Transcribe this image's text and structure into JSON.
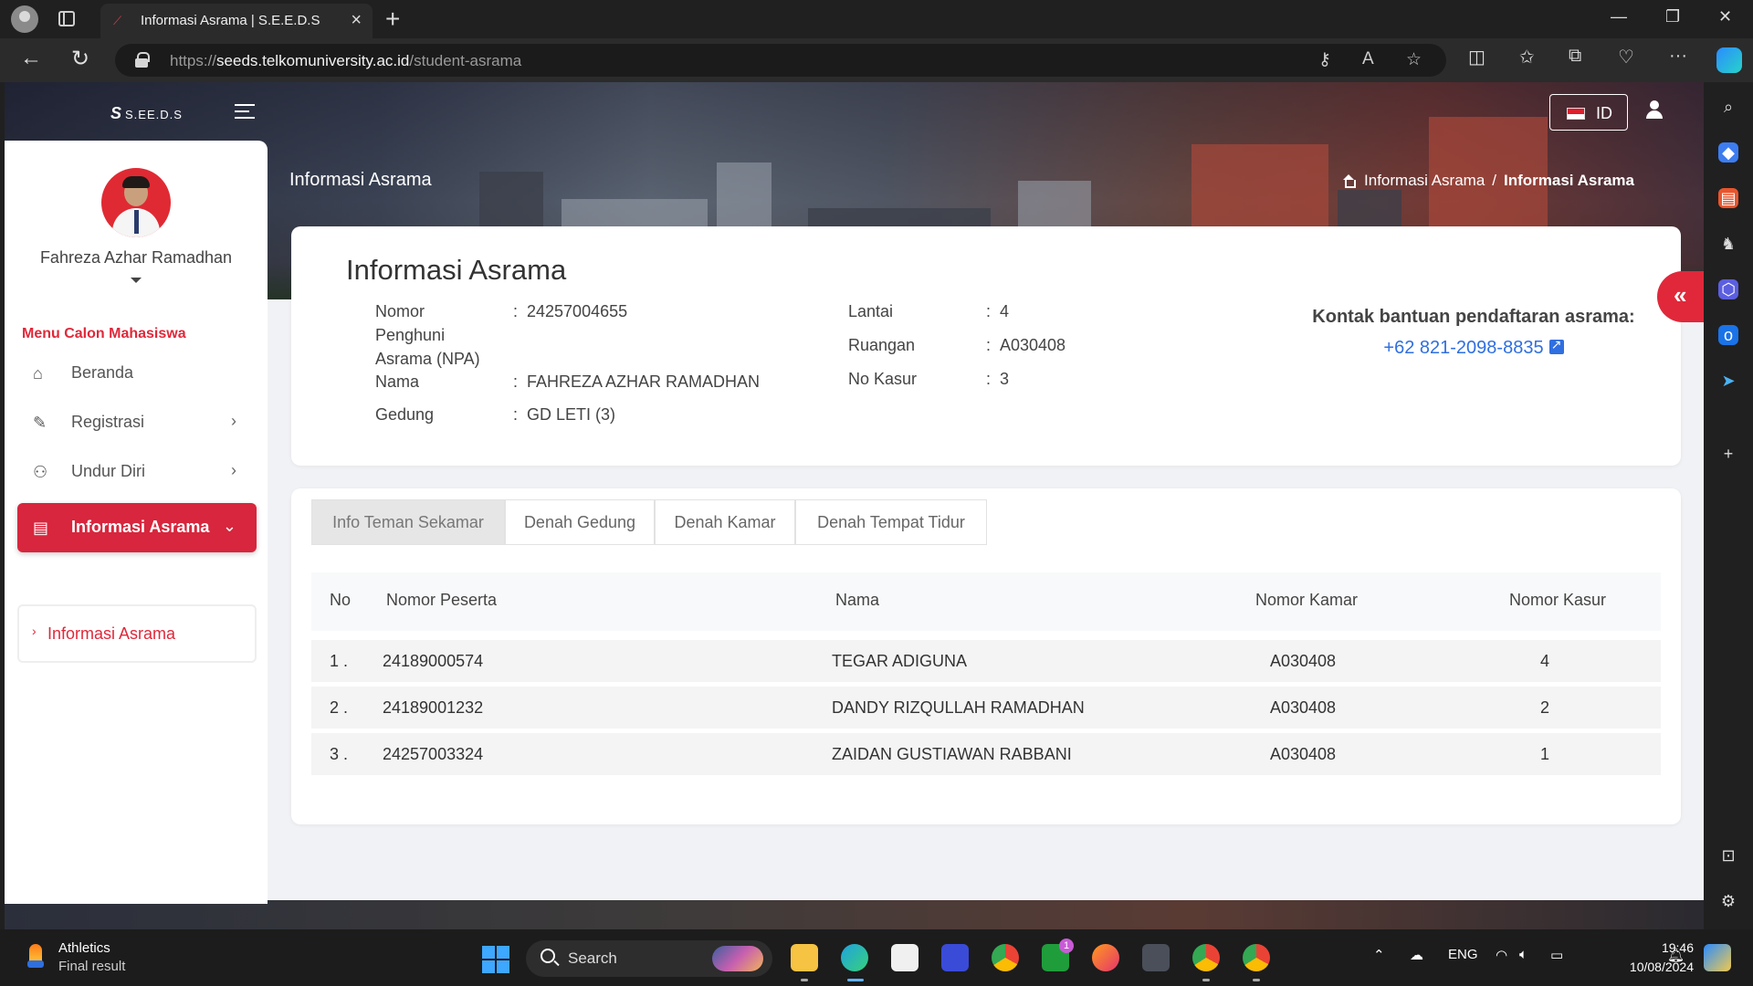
{
  "browser": {
    "tab_title": "Informasi Asrama | S.E.E.D.S",
    "url_scheme": "https://",
    "url_host": "seeds.telkomuniversity.ac.id",
    "url_path": "/student-asrama"
  },
  "header": {
    "logo_text": "S.EE.D.S",
    "lang_label": "ID",
    "page_title": "Informasi Asrama",
    "breadcrumb": [
      "Informasi Asrama",
      "Informasi Asrama"
    ]
  },
  "sidebar": {
    "user_name": "Fahreza Azhar Ramadhan",
    "menu_header": "Menu Calon Mahasiswa",
    "items": [
      {
        "label": "Beranda",
        "icon": "home-icon"
      },
      {
        "label": "Registrasi",
        "icon": "edit-icon"
      },
      {
        "label": "Undur Diri",
        "icon": "user-x-icon"
      },
      {
        "label": "Informasi Asrama",
        "icon": "document-icon"
      }
    ],
    "submenu": [
      {
        "label": "Informasi Asrama"
      }
    ]
  },
  "info": {
    "title": "Informasi Asrama",
    "npa_label": "Nomor Penghuni Asrama (NPA)",
    "npa_value": "24257004655",
    "nama_label": "Nama",
    "nama_value": "FAHREZA AZHAR RAMADHAN",
    "gedung_label": "Gedung",
    "gedung_value": "GD LETI (3)",
    "lantai_label": "Lantai",
    "lantai_value": "4",
    "ruangan_label": "Ruangan",
    "ruangan_value": "A030408",
    "kasur_label": "No Kasur",
    "kasur_value": "3",
    "colon": ":",
    "contact_title": "Kontak bantuan pendaftaran asrama:",
    "contact_phone": "+62 821-2098-8835"
  },
  "tabs": [
    "Info Teman Sekamar",
    "Denah Gedung",
    "Denah Kamar",
    "Denah Tempat Tidur"
  ],
  "table": {
    "headers": [
      "No",
      "Nomor Peserta",
      "Nama",
      "Nomor Kamar",
      "Nomor Kasur"
    ],
    "rows": [
      [
        "1 .",
        "24189000574",
        "TEGAR ADIGUNA",
        "A030408",
        "4"
      ],
      [
        "2 .",
        "24189001232",
        "DANDY RIZQULLAH RAMADHAN",
        "A030408",
        "2"
      ],
      [
        "3 .",
        "24257003324",
        "ZAIDAN GUSTIAWAN RABBANI",
        "A030408",
        "1"
      ]
    ]
  },
  "taskbar": {
    "news_title": "Athletics",
    "news_sub": "Final result",
    "search_label": "Search",
    "lang": "ENG",
    "time": "19:46",
    "date": "10/08/2024",
    "badge_count": "1"
  }
}
